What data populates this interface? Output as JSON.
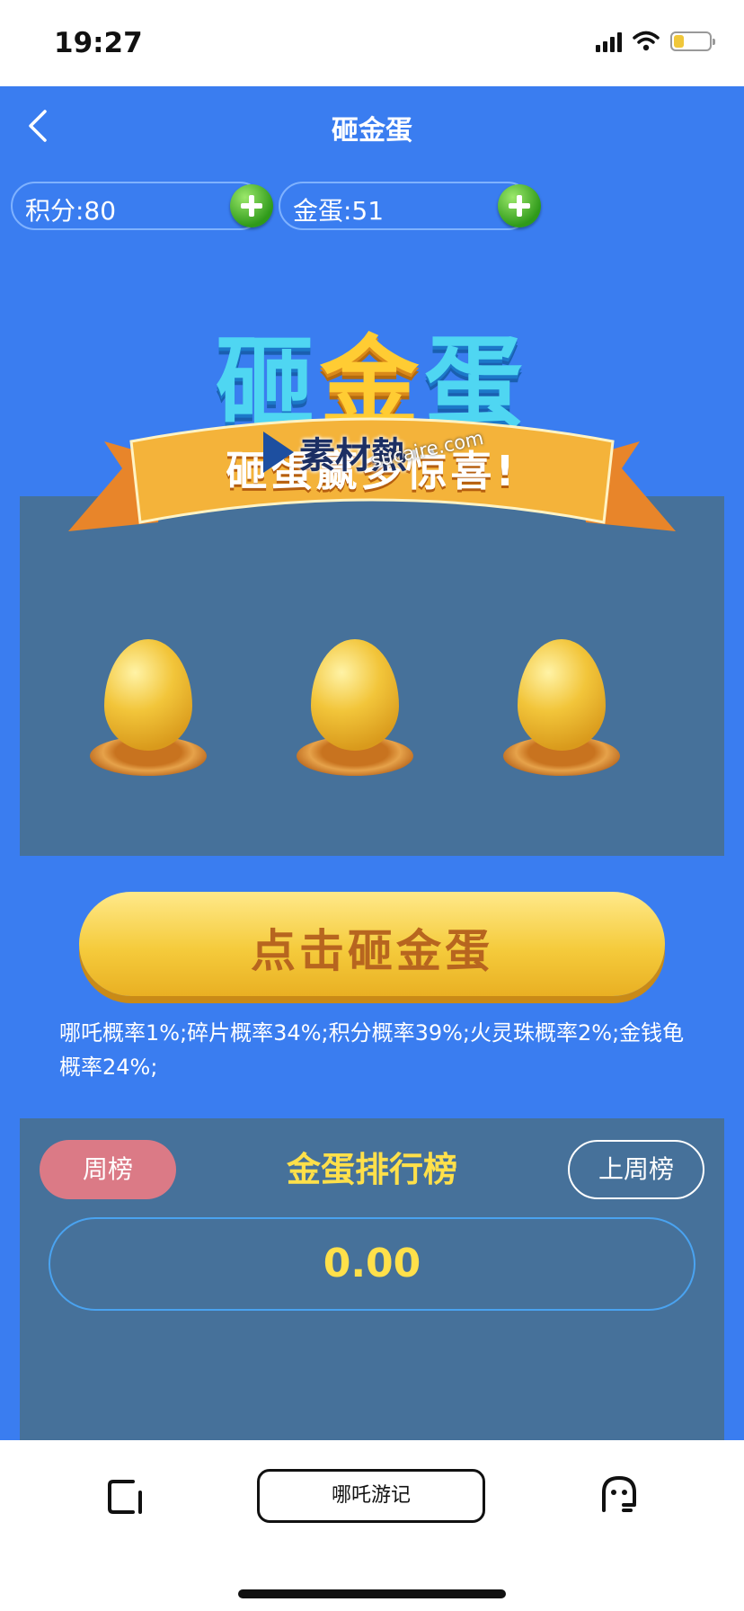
{
  "status_bar": {
    "time": "19:27",
    "battery_level": 0.3
  },
  "nav": {
    "title": "砸金蛋",
    "back_icon": "chevron-left-icon"
  },
  "counters": [
    {
      "label": "积分:80",
      "icon": "plus-icon"
    },
    {
      "label": "金蛋:51",
      "icon": "plus-icon"
    }
  ],
  "banner": {
    "title_part1": "砸",
    "title_part2": "金",
    "title_part3": "蛋",
    "ribbon_text": "砸蛋赢多惊喜!"
  },
  "watermark": {
    "logo_text": "素材熱",
    "url": "sucaire.com"
  },
  "eggs": [
    "golden-egg",
    "golden-egg",
    "golden-egg"
  ],
  "cta": {
    "label": "点击砸金蛋"
  },
  "probability_text": "哪吒概率1%;碎片概率34%;积分概率39%;火灵珠概率2%;金钱龟概率24%;",
  "leaderboard": {
    "weekly_label": "周榜",
    "title": "金蛋排行榜",
    "last_week_label": "上周榜",
    "score": "0.00"
  },
  "tab_bar": {
    "center_label": "哪吒游记",
    "left_icon": "square-icon",
    "right_icon": "ghost-face-icon"
  },
  "colors": {
    "main_blue": "#3a7df0",
    "panel": "#46719a",
    "gold_text": "#ffe04a",
    "pink": "#db7a86"
  }
}
